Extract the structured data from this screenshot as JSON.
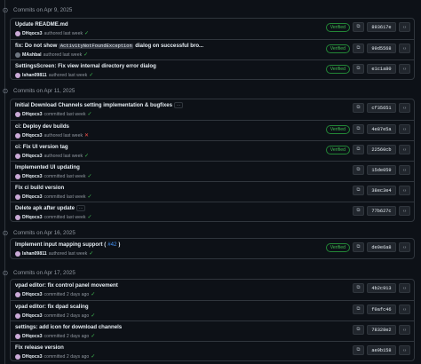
{
  "groups": [
    {
      "title": "Commits on Apr 9, 2025",
      "commits": [
        {
          "message": "Update README.md",
          "author": "DHqocs3",
          "action": "authored last week",
          "status": "check",
          "verified": "Verified",
          "sha": "893617e"
        },
        {
          "message_before": "fix: Do not show",
          "code": "ActivityNotFoundException",
          "message_after": "dialog on successful bro...",
          "author": "MAshbal",
          "avatar_alt": true,
          "action": "authored last week",
          "status": "check",
          "verified": "Verified",
          "sha": "99d5568"
        },
        {
          "message": "SettingsScreen: Fix view internal directory error dialog",
          "author": "Ishan09811",
          "action": "authored last week",
          "status": "check",
          "verified": "Verified",
          "sha": "e1c1a80"
        }
      ]
    },
    {
      "title": "Commits on Apr 11, 2025",
      "commits": [
        {
          "message": "Initial Download Channels setting implementation & bugfixes",
          "ellipsis": "…",
          "author": "DHqocs3",
          "action": "committed last week",
          "status": "check",
          "sha": "cf35651"
        },
        {
          "message": "ci: Deploy dev builds",
          "author": "DHqocs3",
          "action": "authored last week",
          "status": "cross",
          "verified": "Verified",
          "sha": "4e87e5a"
        },
        {
          "message": "ci: Fix UI version tag",
          "author": "DHqocs3",
          "action": "authored last week",
          "status": "check",
          "verified": "Verified",
          "sha": "22560cb"
        },
        {
          "message": "Implemented UI updating",
          "author": "DHqocs3",
          "action": "committed last week",
          "status": "check",
          "sha": "15de059"
        },
        {
          "message": "Fix ci build version",
          "author": "DHqocs3",
          "action": "committed last week",
          "status": "check",
          "sha": "38ec3e4"
        },
        {
          "message": "Delete apk after update",
          "ellipsis": "…",
          "author": "DHqocs3",
          "action": "committed last week",
          "status": "check",
          "sha": "77b627c"
        }
      ]
    },
    {
      "title": "Commits on Apr 16, 2025",
      "commits": [
        {
          "message": "Implement input mapping support (",
          "pr": "#42",
          "message_after": ")",
          "author": "Ishan09811",
          "action": "authored last week",
          "status": "check",
          "verified": "Verified",
          "sha": "de9e6a8"
        }
      ]
    },
    {
      "title": "Commits on Apr 17, 2025",
      "commits": [
        {
          "message": "vpad editor: fix control panel movement",
          "author": "DHqocs3",
          "action": "committed 2 days ago",
          "status": "check",
          "sha": "4b2c913"
        },
        {
          "message": "vpad editor: fix dpad scaling",
          "author": "DHqocs3",
          "action": "committed 2 days ago",
          "status": "check",
          "sha": "f0afc46"
        },
        {
          "message": "settings: add icon for download channels",
          "author": "DHqocs3",
          "action": "committed 2 days ago",
          "status": "check",
          "sha": "78328e2"
        },
        {
          "message": "Fix release version",
          "author": "DHqocs3",
          "action": "committed 2 days ago",
          "status": "check",
          "sha": "ae9b158"
        }
      ]
    }
  ],
  "icons": {
    "commit": "git-commit-icon",
    "copy": "copy-icon",
    "browse": "code-browse-icon",
    "check": "check-icon",
    "cross": "x-icon"
  }
}
